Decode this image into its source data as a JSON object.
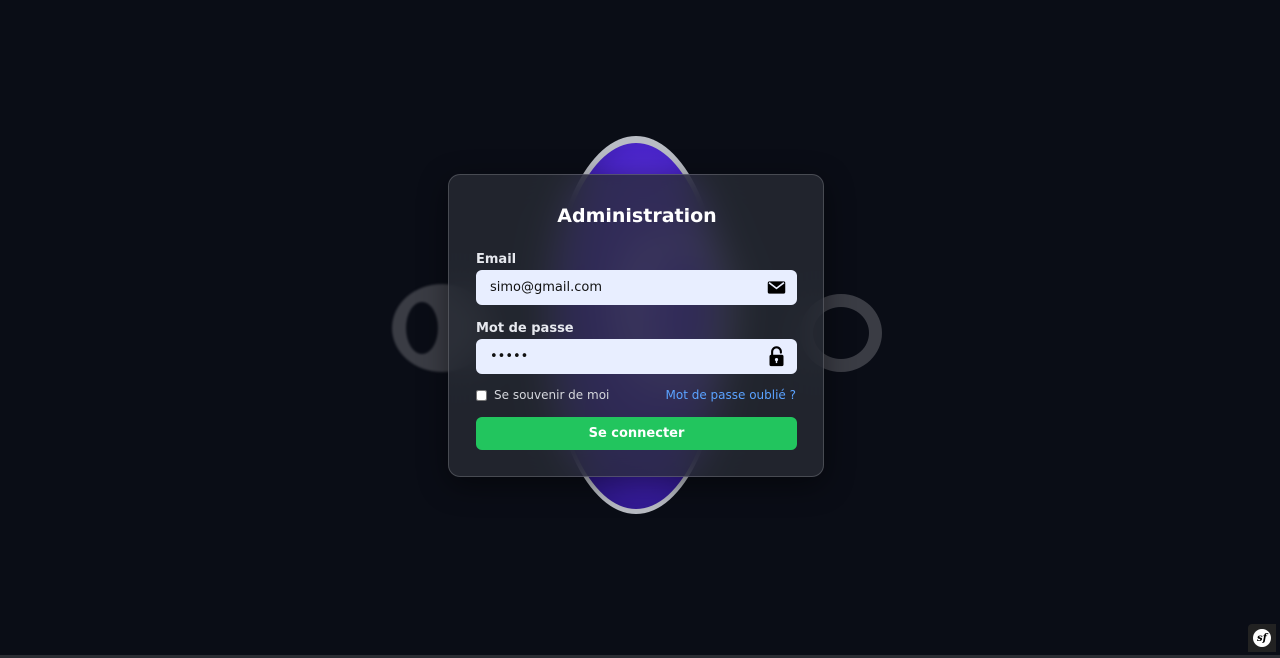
{
  "login": {
    "title": "Administration",
    "email_label": "Email",
    "email_value": "simo@gmail.com",
    "password_label": "Mot de passe",
    "password_value": "•••••",
    "remember_label": "Se souvenir de moi",
    "remember_checked": false,
    "forgot_label": "Mot de passe oublié ?",
    "submit_label": "Se connecter"
  },
  "icons": {
    "email_icon": "envelope-icon",
    "password_icon": "unlocked-padlock-icon",
    "toolbar_icon": "symfony-logo-icon"
  },
  "toolbar": {
    "badge_text": "sf"
  },
  "colors": {
    "background": "#0a0d16",
    "card": "#282c34",
    "input": "#e8eeff",
    "accent_link": "#5aa2ff",
    "submit": "#22c55e",
    "planet": "#4a25c9"
  }
}
